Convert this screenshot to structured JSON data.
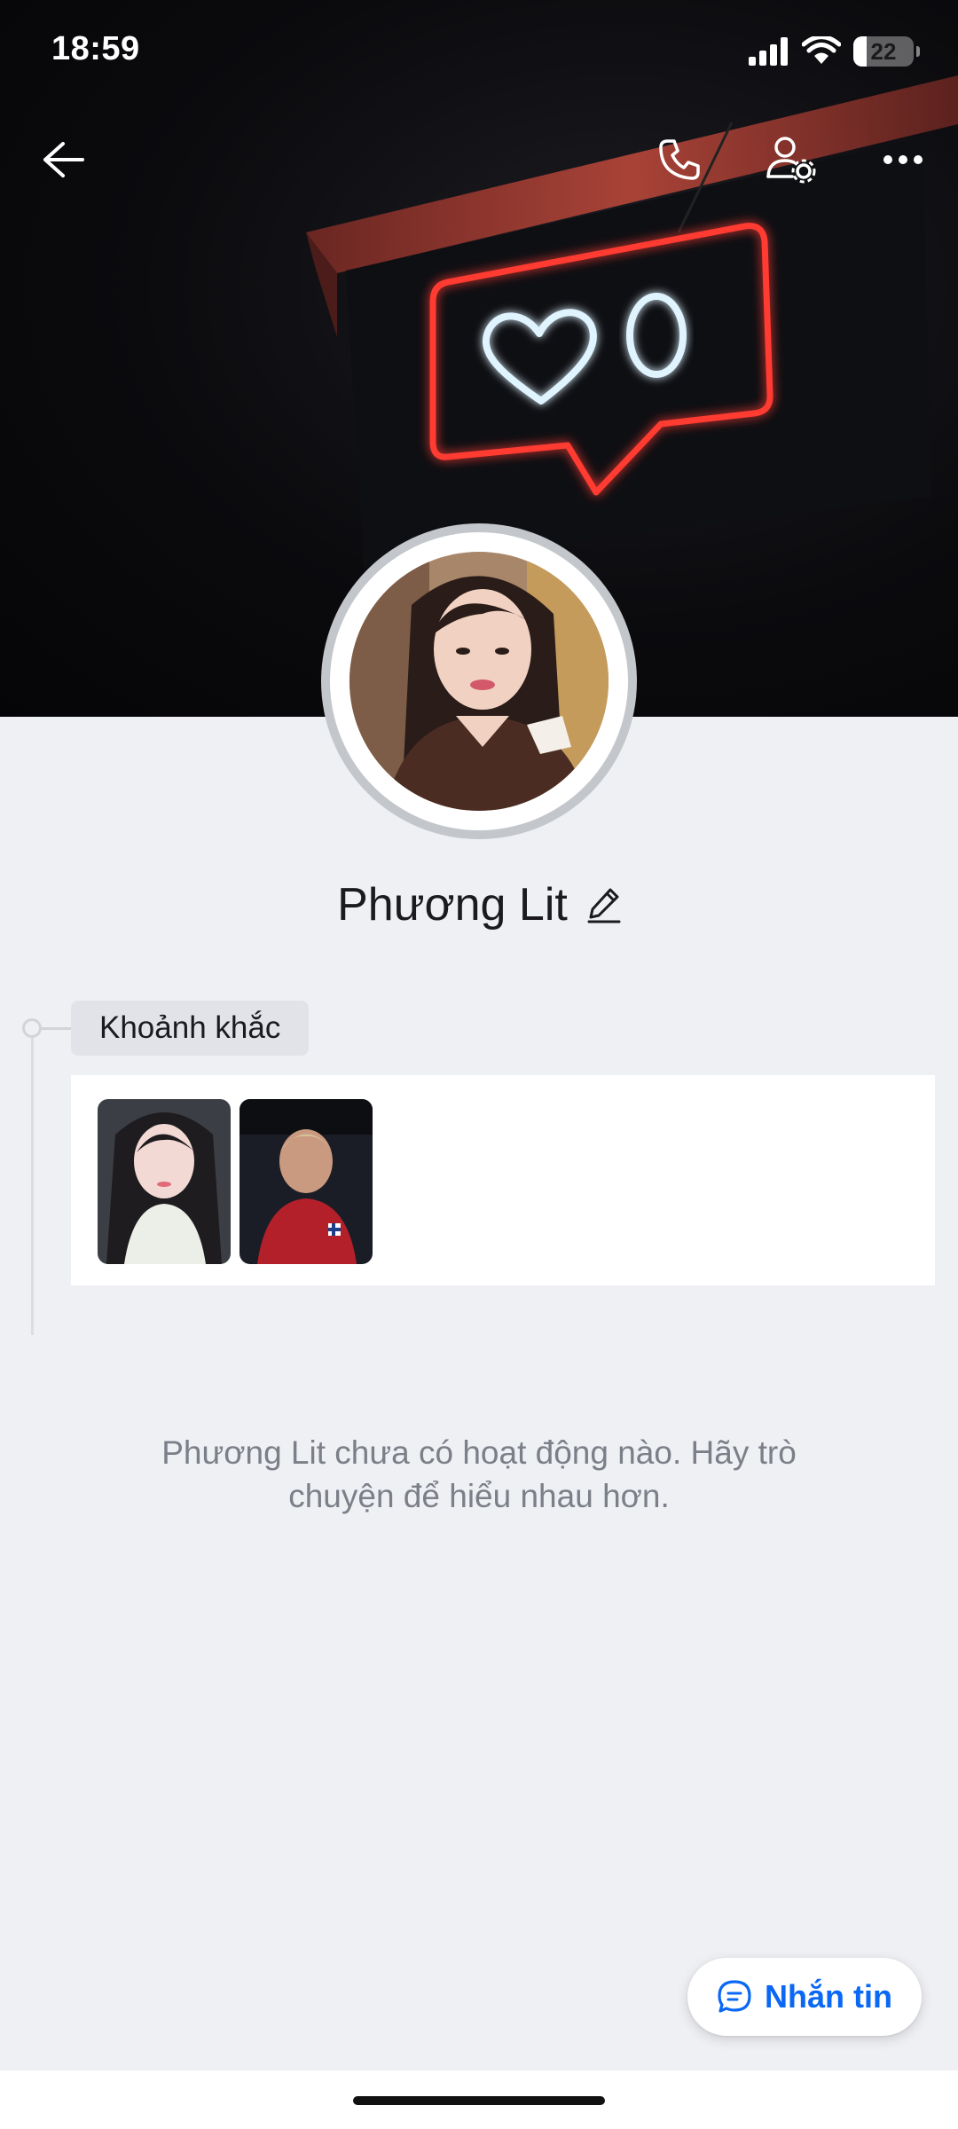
{
  "status_bar": {
    "time": "18:59",
    "battery_level": "22",
    "battery_fraction": 0.22
  },
  "header": {
    "back_icon": "arrow-left-icon",
    "call_icon": "phone-icon",
    "settings_icon": "user-settings-icon",
    "more_icon": "more-horizontal-icon"
  },
  "profile": {
    "name": "Phương Lit",
    "edit_icon": "pencil-icon"
  },
  "moments": {
    "label": "Khoảnh khắc",
    "thumbnail_count": 2
  },
  "empty_state": {
    "message": "Phương Lit chưa có hoạt động nào. Hãy trò chuyện để hiểu nhau hơn."
  },
  "message_button": {
    "label": "Nhắn tin",
    "icon": "chat-bubble-icon"
  },
  "colors": {
    "accent": "#0a68f5",
    "background": "#eff0f4",
    "neon_red": "#ff3b30",
    "neon_white": "#dff4ff"
  }
}
